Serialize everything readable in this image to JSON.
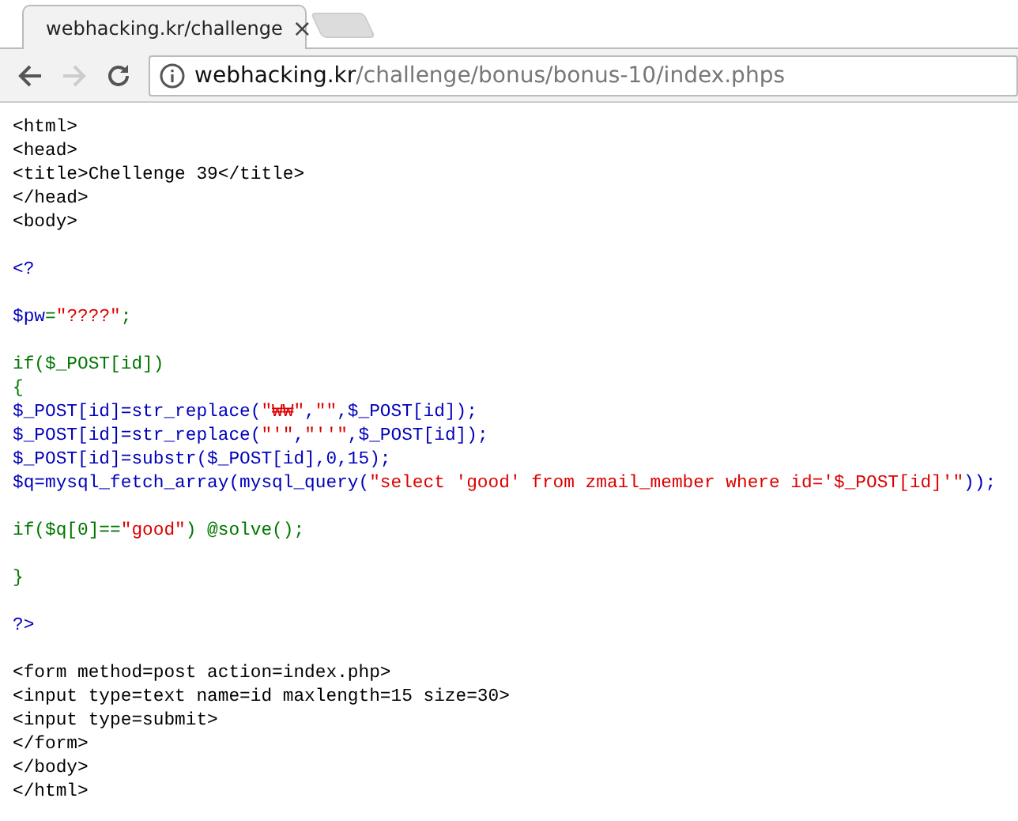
{
  "tab": {
    "title": "webhacking.kr/challenge",
    "close": "×"
  },
  "address_bar": {
    "host": "webhacking.kr",
    "path": "/challenge/bonus/bonus-10/index.phps"
  },
  "source_blocks": [
    {
      "lines": [
        [
          {
            "kind": "html",
            "text": "<html>"
          }
        ],
        [
          {
            "kind": "html",
            "text": "<head>"
          }
        ],
        [
          {
            "kind": "html",
            "text": "<title>Chellenge 39</title>"
          }
        ],
        [
          {
            "kind": "html",
            "text": "</head>"
          }
        ],
        [
          {
            "kind": "html",
            "text": "<body>"
          }
        ]
      ]
    },
    {
      "lines": [
        [
          {
            "kind": "default",
            "text": "<?"
          }
        ]
      ]
    },
    {
      "lines": [
        [
          {
            "kind": "default",
            "text": "$pw"
          },
          {
            "kind": "keyword",
            "text": "="
          },
          {
            "kind": "string",
            "text": "\"????\""
          },
          {
            "kind": "keyword",
            "text": ";"
          }
        ]
      ]
    },
    {
      "lines": [
        [
          {
            "kind": "keyword",
            "text": "if($_POST[id])"
          }
        ],
        [
          {
            "kind": "keyword",
            "text": "{"
          }
        ],
        [
          {
            "kind": "default",
            "text": "$_POST[id]=str_replace("
          },
          {
            "kind": "string",
            "text": "\"₩₩\""
          },
          {
            "kind": "default",
            "text": ","
          },
          {
            "kind": "string",
            "text": "\"\""
          },
          {
            "kind": "default",
            "text": ",$_POST[id]);"
          }
        ],
        [
          {
            "kind": "default",
            "text": "$_POST[id]=str_replace("
          },
          {
            "kind": "string",
            "text": "\"'\""
          },
          {
            "kind": "default",
            "text": ","
          },
          {
            "kind": "string",
            "text": "\"''\""
          },
          {
            "kind": "default",
            "text": ",$_POST[id]);"
          }
        ],
        [
          {
            "kind": "default",
            "text": "$_POST[id]=substr($_POST[id],0,15);"
          }
        ],
        [
          {
            "kind": "default",
            "text": "$q=mysql_fetch_array(mysql_query("
          },
          {
            "kind": "string",
            "text": "\"select 'good' from zmail_member where id='$_POST[id]'\""
          },
          {
            "kind": "default",
            "text": "));"
          }
        ]
      ]
    },
    {
      "lines": [
        [
          {
            "kind": "keyword",
            "text": "if($q[0]=="
          },
          {
            "kind": "string",
            "text": "\"good\""
          },
          {
            "kind": "keyword",
            "text": ") @solve();"
          }
        ]
      ]
    },
    {
      "lines": [
        [
          {
            "kind": "keyword",
            "text": "}"
          }
        ]
      ]
    },
    {
      "lines": [
        [
          {
            "kind": "default",
            "text": "?>"
          }
        ]
      ]
    },
    {
      "lines": [
        [
          {
            "kind": "html",
            "text": "<form method=post action=index.php>"
          }
        ],
        [
          {
            "kind": "html",
            "text": "<input type=text name=id maxlength=15 size=30>"
          }
        ],
        [
          {
            "kind": "html",
            "text": "<input type=submit>"
          }
        ],
        [
          {
            "kind": "html",
            "text": "</form>"
          }
        ],
        [
          {
            "kind": "html",
            "text": "</body>"
          }
        ],
        [
          {
            "kind": "html",
            "text": "</html>"
          }
        ]
      ]
    }
  ]
}
